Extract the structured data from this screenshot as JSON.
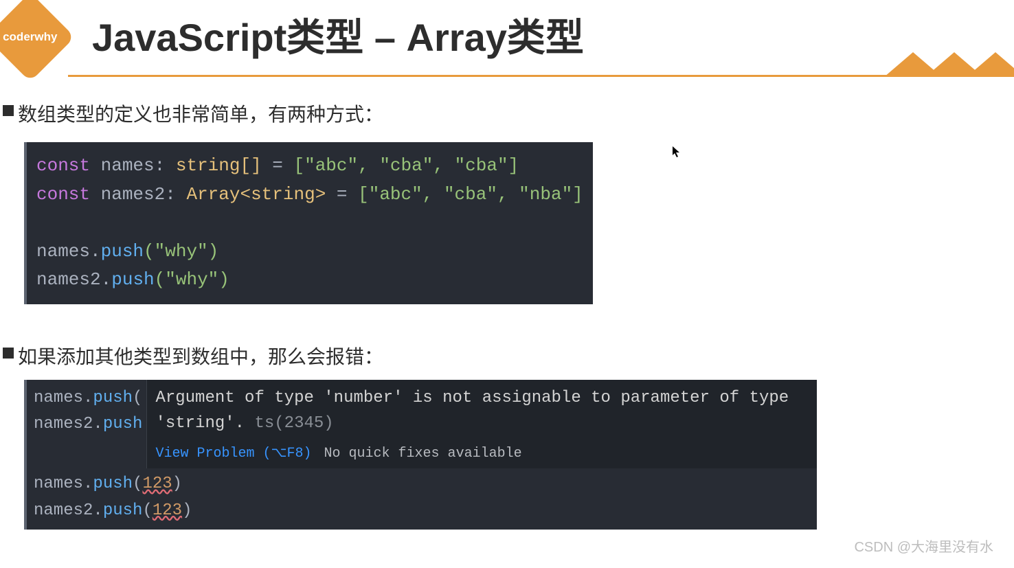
{
  "brand": "coderwhy",
  "title": "JavaScript类型 – Array类型",
  "bullets": {
    "b1": "数组类型的定义也非常简单，有两种方式：",
    "b2": "如果添加其他类型到数组中，那么会报错："
  },
  "code1": {
    "l1_const": "const",
    "l1_name": "names",
    "l1_colon": ": ",
    "l1_type": "string[]",
    "l1_eq": " = ",
    "l1_arr": "[\"abc\", \"cba\", \"cba\"]",
    "l2_const": "const",
    "l2_name": "names2",
    "l2_colon": ": ",
    "l2_type": "Array<string>",
    "l2_eq": " = ",
    "l2_arr": "[\"abc\", \"cba\", \"nba\"]",
    "l4_names": "names",
    "l4_dot": ".",
    "l4_push": "push",
    "l4_arg": "(\"why\")",
    "l5_names2": "names2",
    "l5_dot": ".",
    "l5_push": "push",
    "l5_arg": "(\"why\")"
  },
  "code2": {
    "left_l1_a": "names",
    "left_l1_b": ".",
    "left_l1_c": "push",
    "left_l1_d": "(",
    "left_l2_a": "names2",
    "left_l2_b": ".",
    "left_l2_c": "push",
    "tooltip_msg": "Argument of type 'number' is not assignable to parameter of type 'string'. ",
    "tooltip_code": "ts(2345)",
    "view_problem": "View Problem (⌥F8)",
    "no_fix": "No quick fixes available",
    "lower_l1_a": "names",
    "lower_l1_b": ".",
    "lower_l1_c": "push",
    "lower_l1_d": "(",
    "lower_l1_num": "123",
    "lower_l1_e": ")",
    "lower_l2_a": "names2",
    "lower_l2_b": ".",
    "lower_l2_c": "push",
    "lower_l2_d": "(",
    "lower_l2_num": "123",
    "lower_l2_e": ")"
  },
  "watermark": "CSDN @大海里没有水"
}
